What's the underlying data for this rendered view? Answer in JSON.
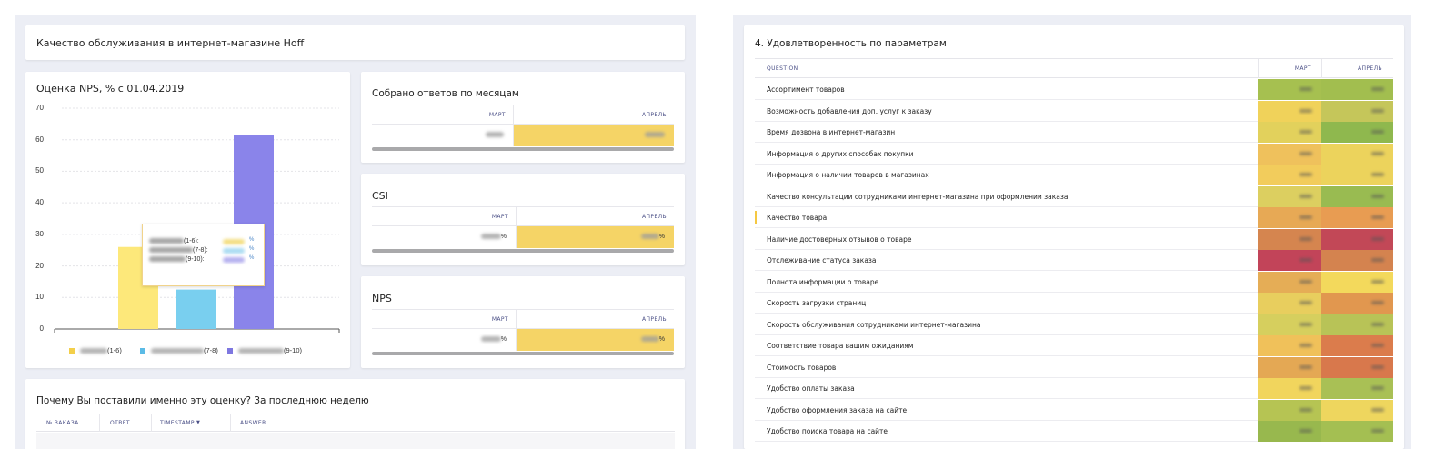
{
  "header": {
    "title": "Качество обслуживания в интернет-магазине Hoff"
  },
  "nps_chart": {
    "title": "Оценка NPS, % с 01.04.2019",
    "tooltip": {
      "lines": [
        "(1-6):",
        "(7-8):",
        "(9-10):"
      ],
      "pct": "%"
    }
  },
  "chart_data": {
    "type": "bar",
    "title": "Оценка NPS, % с 01.04.2019",
    "categories": [
      "(1-6)",
      "(7-8)",
      "(9-10)"
    ],
    "values": [
      26,
      12.5,
      61.5
    ],
    "colors": [
      "#fde87a",
      "#79cfef",
      "#8a84ea"
    ],
    "ylim": [
      0,
      70
    ],
    "yticks": [
      "0",
      "10",
      "20",
      "30",
      "40",
      "50",
      "60",
      "70"
    ],
    "grid": true,
    "legend": [
      "(1-6)",
      "(7-8)",
      "(9-10)"
    ],
    "legend_position": "bottom"
  },
  "answers_card": {
    "title": "Собрано ответов по месяцам",
    "col1": "МАРТ",
    "col2": "АПРЕЛЬ"
  },
  "csi_card": {
    "title": "CSI",
    "col1": "МАРТ",
    "col2": "АПРЕЛЬ",
    "val1_suffix": "%",
    "val2_suffix": "%"
  },
  "nps_card": {
    "title": "NPS",
    "col1": "МАРТ",
    "col2": "АПРЕЛЬ",
    "val1_suffix": "%",
    "val2_suffix": "%"
  },
  "why_card": {
    "title": "Почему Вы поставили именно эту оценку? За последнюю неделю",
    "columns": [
      "№ ЗАКАЗА",
      "ОТВЕТ",
      "TIMESTAMP",
      "ANSWER"
    ],
    "sort_indicator": "▼"
  },
  "satisfaction": {
    "title": "4. Удовлетворенность по параметрам",
    "columns": [
      "QUESTION",
      "МАРТ",
      "АПРЕЛЬ"
    ],
    "rows": [
      {
        "q": "Ассортимент товаров",
        "m": "#a6c050",
        "a": "#a2be4f"
      },
      {
        "q": "Возможность добавления доп. услуг к заказу",
        "m": "#f0d25a",
        "a": "#c5c65a"
      },
      {
        "q": "Время дозвона в интернет-магазин",
        "m": "#e2d15c",
        "a": "#8fb84e"
      },
      {
        "q": "Информация о других способах покупки",
        "m": "#efc15c",
        "a": "#ecd35c"
      },
      {
        "q": "Информация о наличии товаров в магазинах",
        "m": "#f2cc5c",
        "a": "#ecd35c"
      },
      {
        "q": "Качество консультации сотрудниками интернет-магазина при оформлении заказа",
        "m": "#dccf60",
        "a": "#99bb51"
      },
      {
        "q": "Качество товара",
        "m": "#e7a955",
        "a": "#e89c52"
      },
      {
        "q": "Наличие достоверных отзывов о товаре",
        "m": "#d5854f",
        "a": "#c24857"
      },
      {
        "q": "Отслеживание статуса заказа",
        "m": "#c24459",
        "a": "#d4834f"
      },
      {
        "q": "Полнота информации о товаре",
        "m": "#e5ad56",
        "a": "#f3d95c"
      },
      {
        "q": "Скорость загрузки страниц",
        "m": "#e8ce5e",
        "a": "#e1974f"
      },
      {
        "q": "Скорость обслуживания сотрудниками интернет-магазина",
        "m": "#d6cf5e",
        "a": "#b8c357"
      },
      {
        "q": "Соответствие товара вашим ожиданиям",
        "m": "#f0c15a",
        "a": "#db7c4c"
      },
      {
        "q": "Стоимость товаров",
        "m": "#e4a854",
        "a": "#d8784c"
      },
      {
        "q": "Удобство оплаты заказа",
        "m": "#f1d55d",
        "a": "#a9c055"
      },
      {
        "q": "Удобство оформления заказа на сайте",
        "m": "#b6c453",
        "a": "#eed65e"
      },
      {
        "q": "Удобство поиска товара на сайте",
        "m": "#98b84e",
        "a": "#a4bf52"
      }
    ]
  }
}
